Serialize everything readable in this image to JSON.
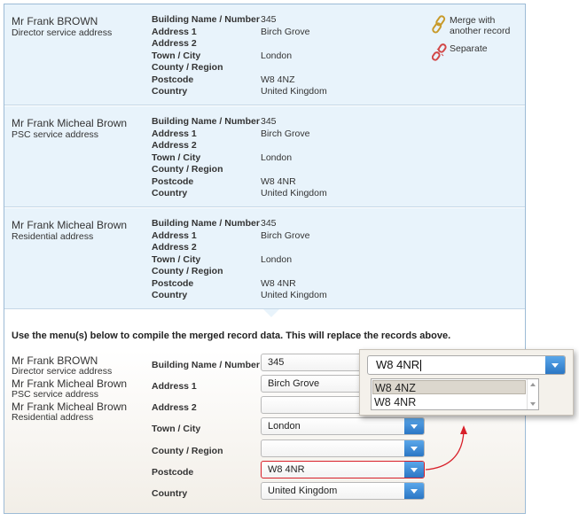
{
  "records": [
    {
      "name": "Mr Frank BROWN",
      "type": "Director service address",
      "fields": [
        {
          "label": "Building Name / Number",
          "value": "345"
        },
        {
          "label": "Address 1",
          "value": "Birch Grove"
        },
        {
          "label": "Address 2",
          "value": ""
        },
        {
          "label": "Town / City",
          "value": "London"
        },
        {
          "label": "County / Region",
          "value": ""
        },
        {
          "label": "Postcode",
          "value": "W8 4NZ"
        },
        {
          "label": "Country",
          "value": "United Kingdom"
        }
      ]
    },
    {
      "name": "Mr Frank Micheal Brown",
      "type": "PSC service address",
      "fields": [
        {
          "label": "Building Name / Number",
          "value": "345"
        },
        {
          "label": "Address 1",
          "value": "Birch Grove"
        },
        {
          "label": "Address 2",
          "value": ""
        },
        {
          "label": "Town / City",
          "value": "London"
        },
        {
          "label": "County / Region",
          "value": ""
        },
        {
          "label": "Postcode",
          "value": "W8 4NR"
        },
        {
          "label": "Country",
          "value": "United Kingdom"
        }
      ]
    },
    {
      "name": "Mr Frank Micheal Brown",
      "type": "Residential address",
      "fields": [
        {
          "label": "Building Name / Number",
          "value": "345"
        },
        {
          "label": "Address 1",
          "value": "Birch Grove"
        },
        {
          "label": "Address 2",
          "value": ""
        },
        {
          "label": "Town / City",
          "value": "London"
        },
        {
          "label": "County / Region",
          "value": ""
        },
        {
          "label": "Postcode",
          "value": "W8 4NR"
        },
        {
          "label": "Country",
          "value": "United Kingdom"
        }
      ]
    }
  ],
  "actions": {
    "merge_line1": "Merge with",
    "merge_line2": "another record",
    "separate": "Separate"
  },
  "merge": {
    "instruction": "Use the menu(s) below to compile the merged record data. This will replace the records above.",
    "people": [
      {
        "name": "Mr Frank BROWN",
        "type": "Director service address"
      },
      {
        "name": "Mr Frank Micheal Brown",
        "type": "PSC service address"
      },
      {
        "name": "Mr Frank Micheal Brown",
        "type": "Residential address"
      }
    ],
    "fields": [
      {
        "label": "Building Name / Number",
        "value": "345"
      },
      {
        "label": "Address 1",
        "value": "Birch Grove"
      },
      {
        "label": "Address 2",
        "value": ""
      },
      {
        "label": "Town / City",
        "value": "London"
      },
      {
        "label": "County / Region",
        "value": ""
      },
      {
        "label": "Postcode",
        "value": "W8 4NR"
      },
      {
        "label": "Country",
        "value": "United Kingdom"
      }
    ]
  },
  "popup": {
    "value": "W8 4NR",
    "options": [
      "W8 4NZ",
      "W8 4NR"
    ]
  },
  "colors": {
    "record_bg": "#e8f3fb",
    "accent_blue": "#2b76c4",
    "highlight_red": "#d8202a"
  },
  "icons": [
    "chain-link-icon",
    "broken-link-icon",
    "dropdown-arrow-icon"
  ]
}
